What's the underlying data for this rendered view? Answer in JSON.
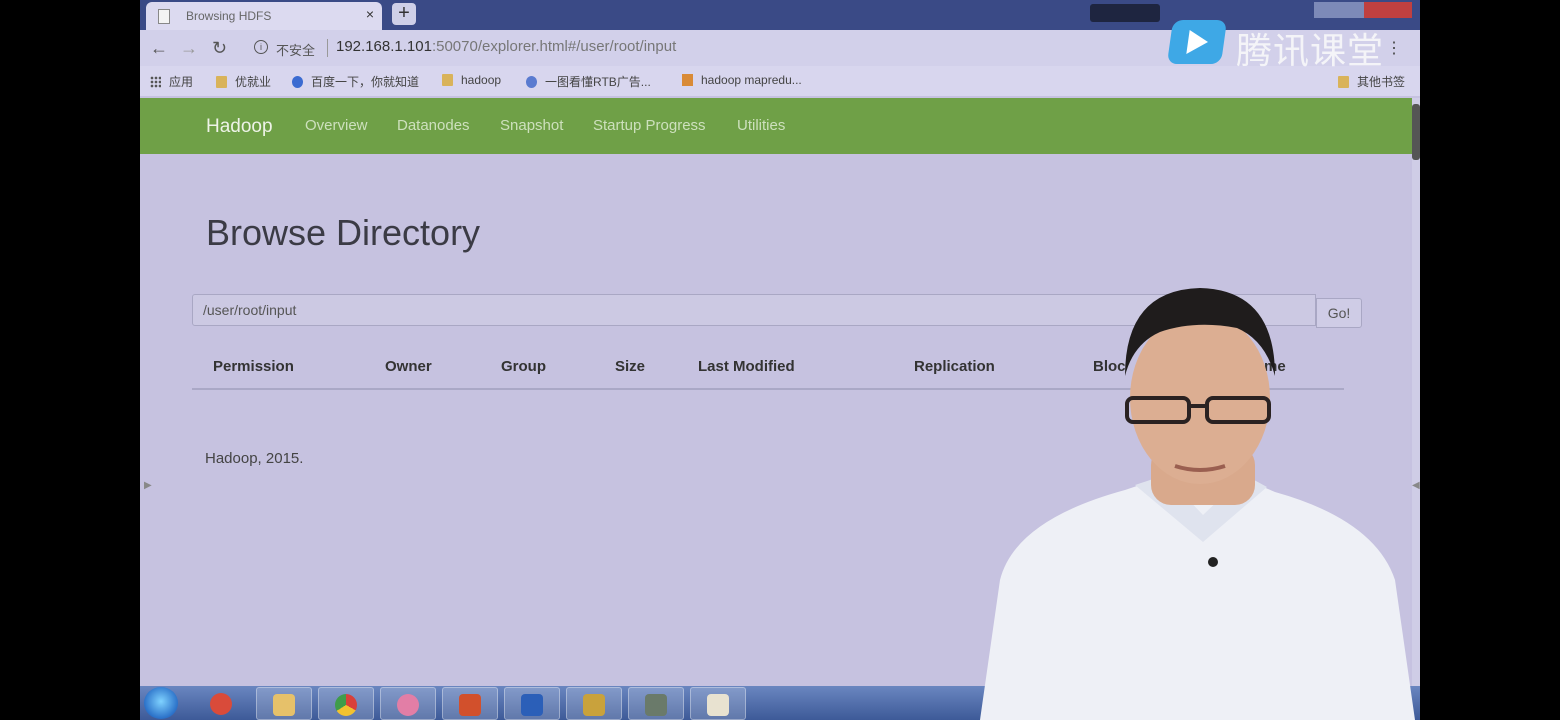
{
  "browser": {
    "tab_title": "Browsing HDFS",
    "tab_close": "×",
    "new_tab": "+",
    "security_label": "不安全",
    "url_host": "192.168.1.101",
    "url_rest": ":50070/explorer.html#/user/root/input",
    "bookmarks": [
      "应用",
      "优就业",
      "百度一下，你就知道",
      "hadoop",
      "一图看懂RTB广告...",
      "hadoop mapredu...",
      "其他书签"
    ]
  },
  "watermark": {
    "brand_name": "腾讯课堂"
  },
  "navbar": {
    "brand": "Hadoop",
    "links": [
      "Overview",
      "Datanodes",
      "Snapshot",
      "Startup Progress",
      "Utilities"
    ]
  },
  "page": {
    "title": "Browse Directory",
    "path_value": "/user/root/input",
    "go_label": "Go!",
    "columns": [
      "Permission",
      "Owner",
      "Group",
      "Size",
      "Last Modified",
      "Replication",
      "Bloc",
      "me"
    ],
    "footer": "Hadoop, 2015."
  },
  "colors": {
    "navbar": "#6fa047",
    "page_background": "#c6c2e0",
    "tabstrip": "#3a4a86"
  }
}
